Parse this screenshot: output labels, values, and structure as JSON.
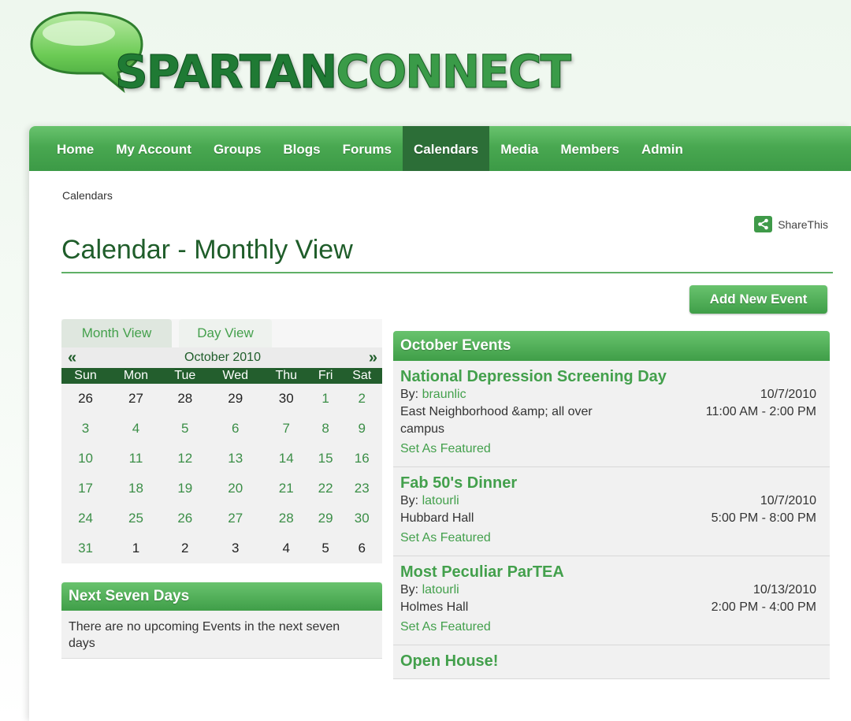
{
  "brand": {
    "part1": "SPARTAN",
    "part2": "CONNECT"
  },
  "nav": [
    {
      "label": "Home",
      "key": "home"
    },
    {
      "label": "My Account",
      "key": "my-account"
    },
    {
      "label": "Groups",
      "key": "groups"
    },
    {
      "label": "Blogs",
      "key": "blogs"
    },
    {
      "label": "Forums",
      "key": "forums"
    },
    {
      "label": "Calendars",
      "key": "calendars",
      "active": true
    },
    {
      "label": "Media",
      "key": "media"
    },
    {
      "label": "Members",
      "key": "members"
    },
    {
      "label": "Admin",
      "key": "admin"
    }
  ],
  "breadcrumb": "Calendars",
  "share_label": "ShareThis",
  "page_title": "Calendar - Monthly View",
  "add_event_label": "Add New Event",
  "calendar": {
    "tabs": {
      "month": "Month View",
      "day": "Day View"
    },
    "prev": "«",
    "next": "»",
    "month_label": "October 2010",
    "weekdays": [
      "Sun",
      "Mon",
      "Tue",
      "Wed",
      "Thu",
      "Fri",
      "Sat"
    ],
    "weeks": [
      [
        {
          "d": "26",
          "o": true
        },
        {
          "d": "27",
          "o": true
        },
        {
          "d": "28",
          "o": true
        },
        {
          "d": "29",
          "o": true
        },
        {
          "d": "30",
          "o": true
        },
        {
          "d": "1"
        },
        {
          "d": "2"
        }
      ],
      [
        {
          "d": "3"
        },
        {
          "d": "4"
        },
        {
          "d": "5"
        },
        {
          "d": "6"
        },
        {
          "d": "7"
        },
        {
          "d": "8"
        },
        {
          "d": "9"
        }
      ],
      [
        {
          "d": "10"
        },
        {
          "d": "11"
        },
        {
          "d": "12"
        },
        {
          "d": "13"
        },
        {
          "d": "14"
        },
        {
          "d": "15"
        },
        {
          "d": "16"
        }
      ],
      [
        {
          "d": "17"
        },
        {
          "d": "18"
        },
        {
          "d": "19"
        },
        {
          "d": "20"
        },
        {
          "d": "21"
        },
        {
          "d": "22"
        },
        {
          "d": "23"
        }
      ],
      [
        {
          "d": "24"
        },
        {
          "d": "25"
        },
        {
          "d": "26"
        },
        {
          "d": "27"
        },
        {
          "d": "28"
        },
        {
          "d": "29"
        },
        {
          "d": "30"
        }
      ],
      [
        {
          "d": "31"
        },
        {
          "d": "1",
          "o": true
        },
        {
          "d": "2",
          "o": true
        },
        {
          "d": "3",
          "o": true
        },
        {
          "d": "4",
          "o": true
        },
        {
          "d": "5",
          "o": true
        },
        {
          "d": "6",
          "o": true
        }
      ]
    ]
  },
  "next_seven": {
    "title": "Next Seven Days",
    "message": "There are no upcoming Events in the next seven days"
  },
  "events_box": {
    "title": "October Events",
    "by_label": "By:",
    "featured_label": "Set As Featured",
    "events": [
      {
        "title": "National Depression Screening Day",
        "author": "braunlic",
        "location": "East Neighborhood &amp; all over campus",
        "date": "10/7/2010",
        "time": "11:00 AM - 2:00 PM"
      },
      {
        "title": "Fab 50's Dinner",
        "author": "latourli",
        "location": "Hubbard Hall",
        "date": "10/7/2010",
        "time": "5:00 PM - 8:00 PM"
      },
      {
        "title": "Most Peculiar ParTEA",
        "author": "latourli",
        "location": "Holmes Hall",
        "date": "10/13/2010",
        "time": "2:00 PM - 4:00 PM"
      },
      {
        "title": "Open House!",
        "author": "",
        "location": "",
        "date": "",
        "time": ""
      }
    ]
  },
  "colors": {
    "brand_green": "#3f9e48",
    "dark_green": "#235e2d",
    "link_green": "#43a04c"
  }
}
